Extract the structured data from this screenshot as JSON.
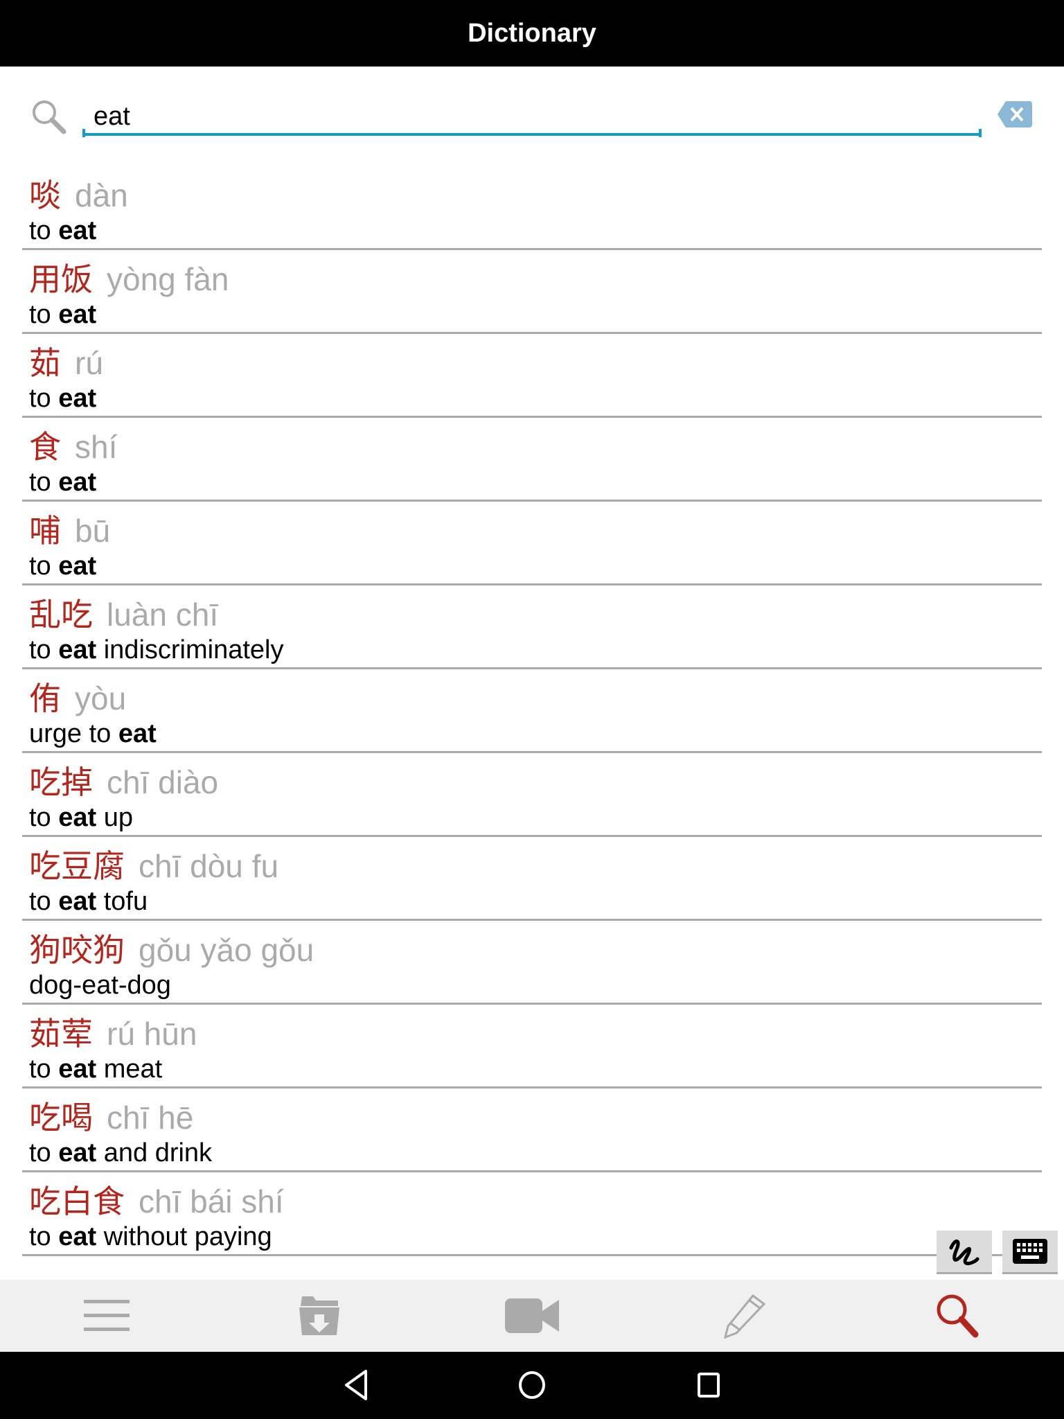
{
  "app": {
    "title": "Dictionary"
  },
  "search": {
    "value": "eat"
  },
  "results": [
    {
      "hanzi": "啖",
      "pinyin": "dàn",
      "def_pre": "to ",
      "def_bold": "eat",
      "def_post": ""
    },
    {
      "hanzi": "用饭",
      "pinyin": "yòng fàn",
      "def_pre": "to ",
      "def_bold": "eat",
      "def_post": ""
    },
    {
      "hanzi": "茹",
      "pinyin": "rú",
      "def_pre": "to ",
      "def_bold": "eat",
      "def_post": ""
    },
    {
      "hanzi": "食",
      "pinyin": "shí",
      "def_pre": "to ",
      "def_bold": "eat",
      "def_post": ""
    },
    {
      "hanzi": "哺",
      "pinyin": "bū",
      "def_pre": "to ",
      "def_bold": "eat",
      "def_post": ""
    },
    {
      "hanzi": "乱吃",
      "pinyin": "luàn chī",
      "def_pre": "to ",
      "def_bold": "eat",
      "def_post": " indiscriminately"
    },
    {
      "hanzi": "侑",
      "pinyin": "yòu",
      "def_pre": "urge to ",
      "def_bold": "eat",
      "def_post": ""
    },
    {
      "hanzi": "吃掉",
      "pinyin": "chī diào",
      "def_pre": "to ",
      "def_bold": "eat",
      "def_post": " up"
    },
    {
      "hanzi": "吃豆腐",
      "pinyin": "chī dòu fu",
      "def_pre": "to ",
      "def_bold": "eat",
      "def_post": " tofu"
    },
    {
      "hanzi": "狗咬狗",
      "pinyin": "gǒu yǎo gǒu",
      "def_pre": "dog-eat-dog",
      "def_bold": "",
      "def_post": ""
    },
    {
      "hanzi": "茹荤",
      "pinyin": "rú hūn",
      "def_pre": "to ",
      "def_bold": "eat",
      "def_post": " meat"
    },
    {
      "hanzi": "吃喝",
      "pinyin": "chī hē",
      "def_pre": "to ",
      "def_bold": "eat",
      "def_post": " and drink"
    },
    {
      "hanzi": "吃白食",
      "pinyin": "chī bái shí",
      "def_pre": "to ",
      "def_bold": "eat",
      "def_post": " without paying"
    }
  ],
  "input_modes": [
    "handwriting-icon",
    "keyboard-icon"
  ],
  "bottom_nav": [
    {
      "icon": "menu-icon",
      "active": false
    },
    {
      "icon": "archive-download-icon",
      "active": false
    },
    {
      "icon": "video-camera-icon",
      "active": false
    },
    {
      "icon": "pencil-icon",
      "active": false
    },
    {
      "icon": "search-icon",
      "active": true
    }
  ],
  "colors": {
    "accent": "#139dc0",
    "hanzi": "#b3261e",
    "pinyin": "#aaaaaa",
    "active_nav": "#b3261e",
    "inactive_nav": "#aaaaaa"
  }
}
